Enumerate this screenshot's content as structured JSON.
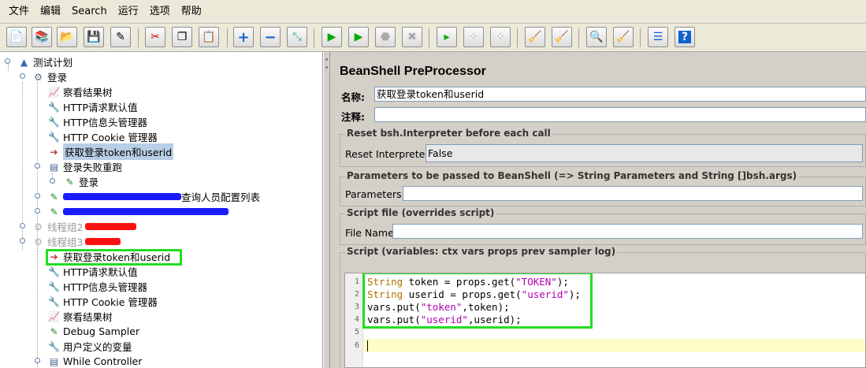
{
  "menu": [
    "文件",
    "编辑",
    "Search",
    "运行",
    "选项",
    "帮助"
  ],
  "toolbar": {
    "icons": [
      "new-icon",
      "templates-icon",
      "open-icon",
      "save-icon",
      "save-as-icon",
      "cut-icon",
      "copy-icon",
      "paste-icon",
      "expand-icon",
      "collapse-icon",
      "toggle-icon",
      "start-icon",
      "start-no-pause-icon",
      "stop-icon",
      "shutdown-icon",
      "remote-start-icon",
      "remote-stop-icon",
      "remote-shutdown-icon",
      "clear-icon",
      "clear-all-icon",
      "search-icon",
      "reset-search-icon",
      "function-helper-icon",
      "help-icon"
    ]
  },
  "tree": {
    "nodes": [
      {
        "label": "测试计划",
        "icon": "test-plan-icon"
      },
      {
        "label": "登录",
        "icon": "thread-group-icon"
      },
      {
        "label": "察看结果树",
        "icon": "listener-icon"
      },
      {
        "label": "HTTP请求默认值",
        "icon": "config-icon"
      },
      {
        "label": "HTTP信息头管理器",
        "icon": "config-icon"
      },
      {
        "label": "HTTP Cookie 管理器",
        "icon": "config-icon"
      },
      {
        "label": "获取登录token和userid",
        "icon": "preprocessor-icon"
      },
      {
        "label": "登录失败重跑",
        "icon": "controller-icon"
      },
      {
        "label": "登录",
        "icon": "sampler-icon"
      },
      {
        "label": "查询人员配置列表",
        "icon": "sampler-icon"
      },
      {
        "label": "",
        "icon": "sampler-icon"
      },
      {
        "label": "线程组2",
        "icon": "thread-group-icon"
      },
      {
        "label": "线程组3",
        "icon": "thread-group-icon"
      },
      {
        "label": "获取登录token和userid",
        "icon": "preprocessor-icon"
      },
      {
        "label": "HTTP请求默认值",
        "icon": "config-icon"
      },
      {
        "label": "HTTP信息头管理器",
        "icon": "config-icon"
      },
      {
        "label": "HTTP Cookie 管理器",
        "icon": "config-icon"
      },
      {
        "label": "察看结果树",
        "icon": "listener-icon"
      },
      {
        "label": "Debug Sampler",
        "icon": "sampler-icon"
      },
      {
        "label": "用户定义的变量",
        "icon": "config-icon"
      },
      {
        "label": "While Controller",
        "icon": "controller-icon"
      }
    ]
  },
  "panel": {
    "title": "BeanShell PreProcessor",
    "name_label": "名称:",
    "name_value": "获取登录token和userid",
    "comment_label": "注释:",
    "comment_value": "",
    "reset_group": "Reset bsh.Interpreter before each call",
    "reset_label": "Reset Interpreter:",
    "reset_value": "False",
    "params_group": "Parameters to be passed to BeanShell (=> String Parameters and String []bsh.args)",
    "params_label": "Parameters:",
    "params_value": "",
    "file_group": "Script file (overrides script)",
    "file_label": "File Name:",
    "file_value": "",
    "script_group": "Script (variables: ctx vars props prev sampler log)"
  },
  "script": {
    "line_numbers": [
      "1",
      "2",
      "3",
      "4",
      "5",
      "6"
    ],
    "l1": {
      "kw": "String",
      "mid": " token = props.get(",
      "str": "\"TOKEN\"",
      "end": ");"
    },
    "l2": {
      "kw": "String",
      "mid": " userid = props.get(",
      "str": "\"userid\"",
      "end": ");"
    },
    "l3": {
      "pre": "vars.put(",
      "str": "\"token\"",
      "end": ",token);"
    },
    "l4": {
      "pre": "vars.put(",
      "str": "\"userid\"",
      "end": ",userid);"
    }
  },
  "colors": {
    "highlight": "#22dd22",
    "redact_blue": "#1a1aff",
    "redact_red": "#ff1010",
    "selection": "#b8cfe5"
  }
}
